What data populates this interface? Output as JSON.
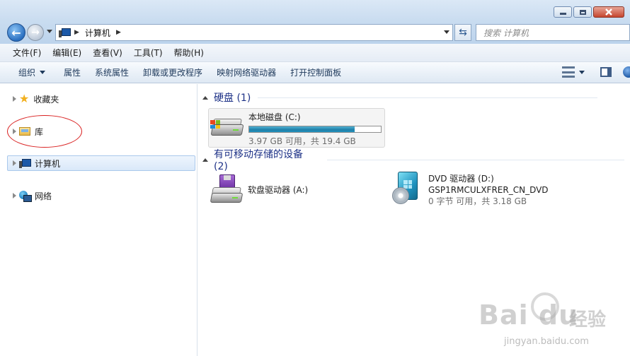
{
  "titlebar": {
    "minimize_icon": "minimize-icon",
    "maximize_icon": "maximize-icon",
    "close_icon": "close-icon"
  },
  "address": {
    "path_root": "计算机",
    "search_placeholder": "搜索 计算机"
  },
  "menu": [
    "文件(F)",
    "编辑(E)",
    "查看(V)",
    "工具(T)",
    "帮助(H)"
  ],
  "toolbar": {
    "organize": "组织",
    "items": [
      "属性",
      "系统属性",
      "卸载或更改程序",
      "映射网络驱动器",
      "打开控制面板"
    ]
  },
  "nav": {
    "favorites": "收藏夹",
    "libraries": "库",
    "computer": "计算机",
    "network": "网络"
  },
  "groups": {
    "hdd_title": "硬盘 (1)",
    "removable_title": "有可移动存储的设备 (2)"
  },
  "drives": {
    "local": {
      "name": "本地磁盘 (C:)",
      "free": "3.97 GB 可用，共 19.4 GB",
      "used_fraction": 0.8
    },
    "floppy": {
      "name": "软盘驱动器 (A:)"
    },
    "dvd": {
      "name": "DVD 驱动器 (D:)",
      "label": "GSP1RMCULXFRER_CN_DVD",
      "free": "0 字节 可用，共 3.18 GB"
    }
  },
  "watermark": {
    "brand": "Bai du",
    "cn": "经验",
    "url": "jingyan.baidu.com"
  },
  "colors": {
    "accent": "#1e3287",
    "selection": "#d9e8f9",
    "usage_bar": "#2593bf",
    "annotation": "#d92020"
  }
}
